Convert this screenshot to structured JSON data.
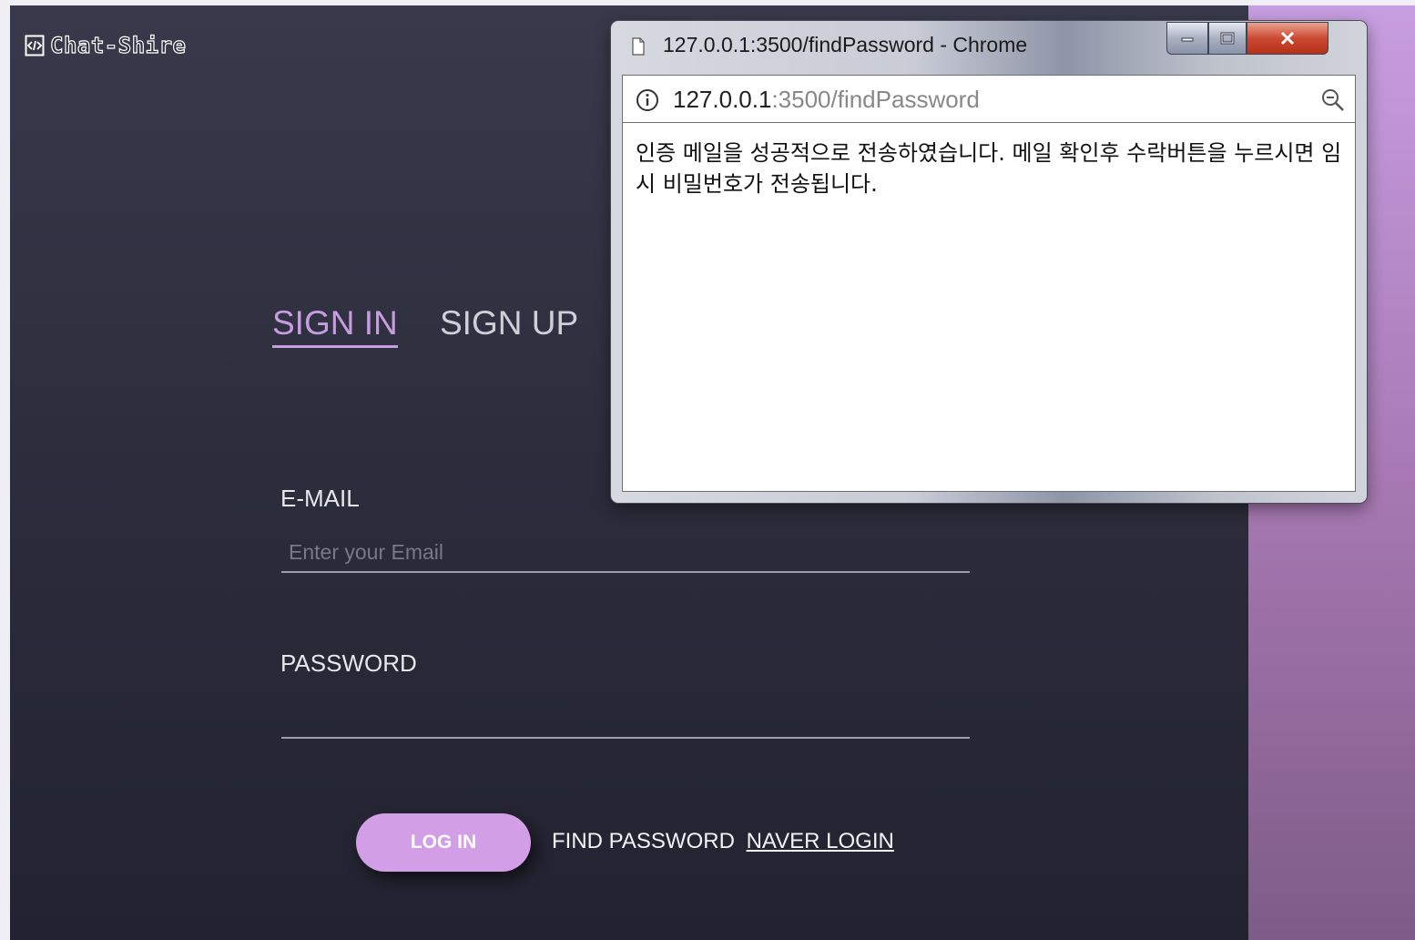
{
  "brand": {
    "name": "Chat-Shire"
  },
  "tabs": {
    "signin": "SIGN IN",
    "signup": "SIGN UP"
  },
  "form": {
    "email_label": "E-MAIL",
    "email_placeholder": "Enter your Email",
    "password_label": "PASSWORD",
    "login_button": "LOG IN",
    "find_password": "FIND PASSWORD",
    "naver_login": "NAVER LOGIN"
  },
  "popup": {
    "title": "127.0.0.1:3500/findPassword - Chrome",
    "url_host": "127.0.0.1",
    "url_path": ":3500/findPassword",
    "message": "인증 메일을 성공적으로 전송하였습니다. 메일 확인후 수락버튼을 누르시면 임시 비밀번호가 전송됩니다."
  },
  "colors": {
    "accent": "#c89ce0",
    "button": "#d29fe6",
    "panel_dark": "#2d2e3d",
    "close_red": "#cc4a31"
  },
  "icons": [
    "code-icon",
    "page-icon",
    "minimize-icon",
    "maximize-icon",
    "close-icon",
    "info-icon",
    "zoom-out-icon"
  ]
}
